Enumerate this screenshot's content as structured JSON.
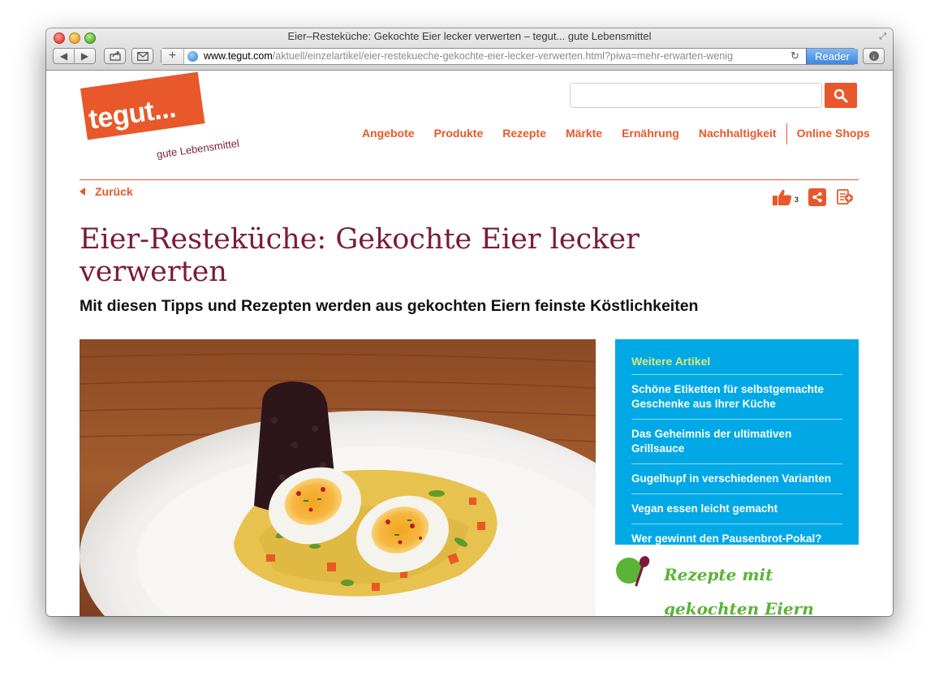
{
  "browser": {
    "window_title": "Eier–Resteküche: Gekochte Eier lecker verwerten – tegut... gute Lebensmittel",
    "url_domain": "www.tegut.com",
    "url_path": "/aktuell/einzelartikel/eier-restekueche-gekochte-eier-lecker-verwerten.html?piwa=mehr-erwarten-wenig",
    "reader_label": "Reader"
  },
  "site": {
    "logo_text": "tegut...",
    "logo_tagline": "gute Lebensmittel",
    "search": {
      "placeholder": "",
      "value": ""
    },
    "nav": [
      "Angebote",
      "Produkte",
      "Rezepte",
      "Märkte",
      "Ernährung",
      "Nachhaltigkeit"
    ],
    "nav_shops": "Online Shops",
    "accent_color": "#e8582a"
  },
  "article": {
    "back_label": "Zurück",
    "like_count": "3",
    "title": "Eier-Resteküche: Gekochte Eier lecker verwerten",
    "subtitle": "Mit diesen Tipps und Rezepten werden aus gekochten Eiern feinste Köstlichkeiten",
    "title_color": "#7b1a3a"
  },
  "sidebar": {
    "title": "Weitere Artikel",
    "items": [
      "Schöne Etiketten für selbstgemachte Geschenke aus Ihrer Küche",
      "Das Geheimnis der ultimativen Grillsauce",
      "Gugelhupf in verschiedenen Varianten",
      "Vegan essen leicht gemacht",
      "Wer gewinnt den Pausenbrot-Pokal?"
    ],
    "background": "#00a9e6"
  },
  "recipes_teaser": "Rezepte mit gekochten Eiern"
}
